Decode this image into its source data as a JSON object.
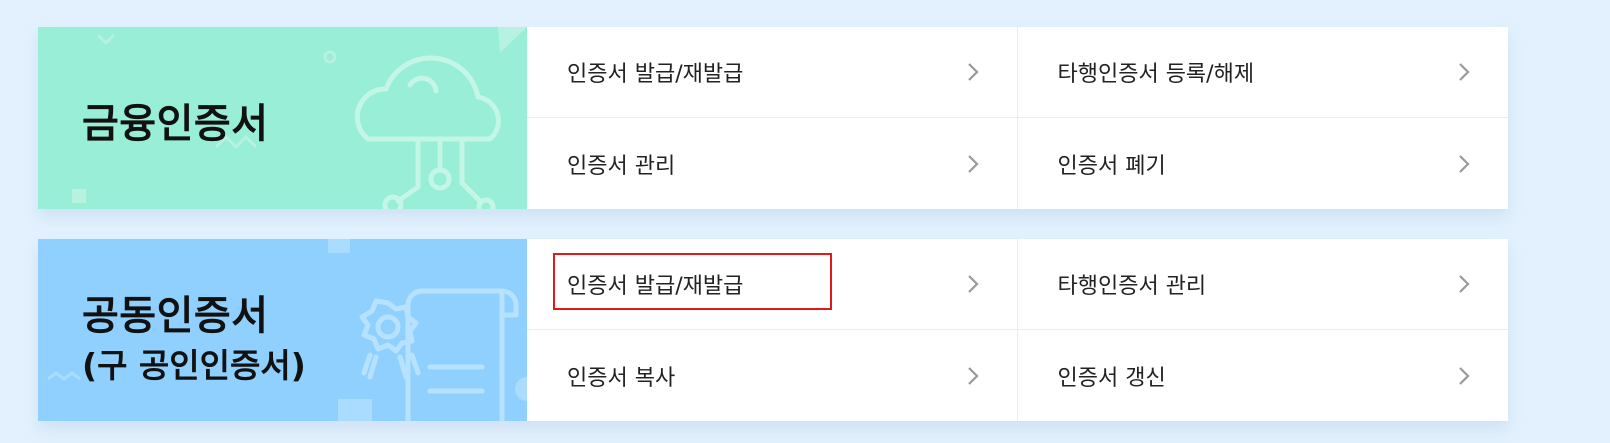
{
  "sections": [
    {
      "title": "금융인증서",
      "subtitle": "",
      "items": [
        {
          "label": "인증서 발급/재발급"
        },
        {
          "label": "타행인증서 등록/해제"
        },
        {
          "label": "인증서 관리"
        },
        {
          "label": "인증서 폐기"
        }
      ]
    },
    {
      "title": "공동인증서",
      "subtitle": "(구 공인인증서)",
      "items": [
        {
          "label": "인증서 발급/재발급"
        },
        {
          "label": "타행인증서 관리"
        },
        {
          "label": "인증서 복사"
        },
        {
          "label": "인증서 갱신"
        }
      ]
    }
  ],
  "colors": {
    "financial_banner": "#98eed6",
    "joint_banner": "#8fd0ff",
    "page_background": "#e2f1fd",
    "highlight": "#e0191b"
  },
  "icons": {
    "item_arrow": "chevron-right-icon",
    "financial_banner": "cloud-circuit-icon",
    "joint_banner": "certificate-scroll-icon"
  }
}
